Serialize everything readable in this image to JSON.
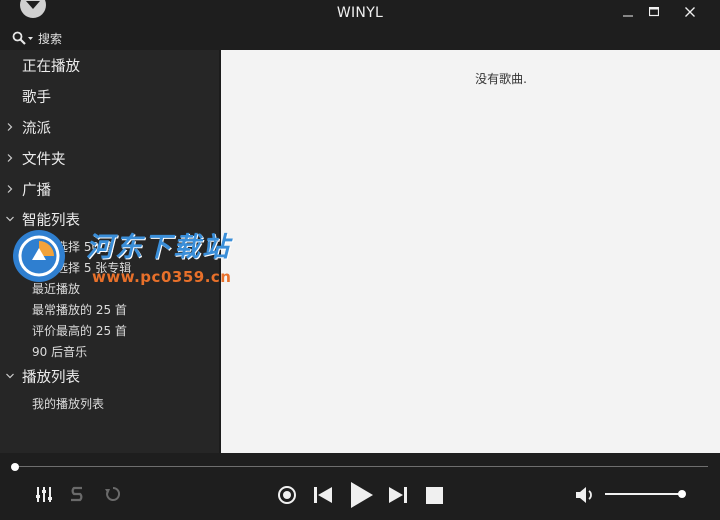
{
  "window": {
    "title": "WINYL"
  },
  "search": {
    "label": "搜索"
  },
  "sidebar": {
    "items": [
      {
        "label": "正在播放"
      },
      {
        "label": "歌手"
      },
      {
        "label": "流派"
      },
      {
        "label": "文件夹"
      },
      {
        "label": "广播"
      },
      {
        "label": "智能列表"
      },
      {
        "label": "播放列表"
      }
    ],
    "smart_lists": [
      "随机选择 50 首",
      "随机选择 5 张专辑",
      "最近播放",
      "最常播放的 25 首",
      "评价最高的 25 首",
      "90 后音乐"
    ],
    "playlists": [
      "我的播放列表"
    ]
  },
  "main": {
    "empty_message": "没有歌曲."
  },
  "player": {
    "seek_progress": 0.0,
    "volume": 1.0
  },
  "watermark": {
    "title": "河东下载站",
    "url": "www.pc0359.cn"
  },
  "colors": {
    "background": "#1e1e1e",
    "sidebar": "#262626",
    "main": "#f3f3f3",
    "accent": "#ffffff"
  }
}
